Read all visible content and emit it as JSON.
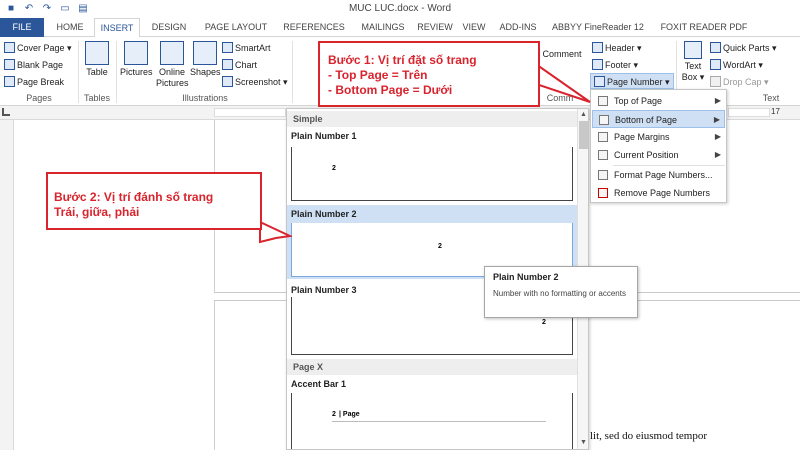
{
  "window": {
    "title": "MUC LUC.docx - Word"
  },
  "tabs": [
    "FILE",
    "HOME",
    "INSERT",
    "DESIGN",
    "PAGE LAYOUT",
    "REFERENCES",
    "MAILINGS",
    "REVIEW",
    "VIEW",
    "ADD-INS",
    "ABBYY FineReader 12",
    "FOXIT READER PDF"
  ],
  "ribbon": {
    "pages": {
      "cover_page": "Cover Page",
      "blank_page": "Blank Page",
      "page_break": "Page Break",
      "label": "Pages"
    },
    "tables": {
      "table": "Table",
      "label": "Tables"
    },
    "illustrations": {
      "pictures": "Pictures",
      "online_pictures_1": "Online",
      "online_pictures_2": "Pictures",
      "shapes": "Shapes",
      "smartart": "SmartArt",
      "chart": "Chart",
      "screenshot": "Screenshot",
      "label": "Illustrations"
    },
    "comments": {
      "comment": "Comment",
      "label": "Comm"
    },
    "header_footer": {
      "header": "Header",
      "footer": "Footer",
      "page_number": "Page Number"
    },
    "text": {
      "text_box_1": "Text",
      "text_box_2": "Box",
      "quick_parts": "Quick Parts",
      "wordart": "WordArt",
      "drop_cap": "Drop Cap",
      "label": "Text"
    }
  },
  "page_number_menu": [
    {
      "label": "Top of Page",
      "submenu": true
    },
    {
      "label": "Bottom of Page",
      "submenu": true,
      "highlighted": true
    },
    {
      "label": "Page Margins",
      "submenu": true
    },
    {
      "label": "Current Position",
      "submenu": true
    },
    {
      "label": "Format Page Numbers...",
      "submenu": false
    },
    {
      "label": "Remove Page Numbers",
      "submenu": false
    }
  ],
  "gallery": {
    "section_simple": "Simple",
    "items": [
      {
        "label": "Plain Number 1",
        "num": "2"
      },
      {
        "label": "Plain Number 2",
        "num": "2",
        "selected": true
      },
      {
        "label": "Plain Number 3",
        "num": "2"
      }
    ],
    "section_pagex": "Page X",
    "accent": {
      "label": "Accent Bar 1",
      "num": "2",
      "text": "| Page"
    }
  },
  "tooltip": {
    "title": "Plain Number 2",
    "desc": "Number with no formatting or accents"
  },
  "callouts": {
    "step1": [
      "Bước 1: Vị trí đặt số trang",
      "- Top Page = Trên",
      "- Bottom Page = Dưới"
    ],
    "step2": [
      "Bước 2: Vị trí đánh số trang",
      "Trái, giữa, phải"
    ]
  },
  "document": {
    "text": "lit, sed do eiusmod tempor"
  },
  "ruler": {
    "mark": "17"
  },
  "colors": {
    "accent": "#2b579a",
    "callout": "#d9232d",
    "highlight": "#cfe0f5"
  }
}
